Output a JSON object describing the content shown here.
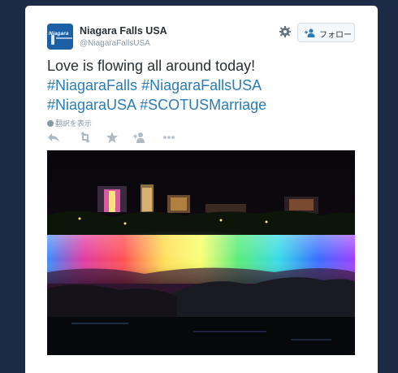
{
  "tweet": {
    "author_name": "Niagara Falls USA",
    "author_handle": "@NiagaraFallsUSA",
    "avatar_text": "Niagara",
    "follow_label": "フォロー",
    "text_plain": "Love is flowing all around today!",
    "hashtags": [
      "#NiagaraFalls",
      "#NiagaraFallsUSA",
      "#NiagaraUSA",
      "#SCOTUSMarriage"
    ],
    "translate_label": "翻訳を表示"
  },
  "icons": {
    "settings": "gear-icon",
    "follow": "add-user-icon",
    "reply": "reply-icon",
    "retweet": "retweet-icon",
    "favorite": "star-icon",
    "follow_action": "add-user-icon",
    "more": "more-dots-icon"
  },
  "colors": {
    "page_background": "#1c2a46",
    "hashtag": "#2b7bb9",
    "text": "#292f33",
    "muted": "#8899a6",
    "action_icons": "#b1bbc3"
  }
}
